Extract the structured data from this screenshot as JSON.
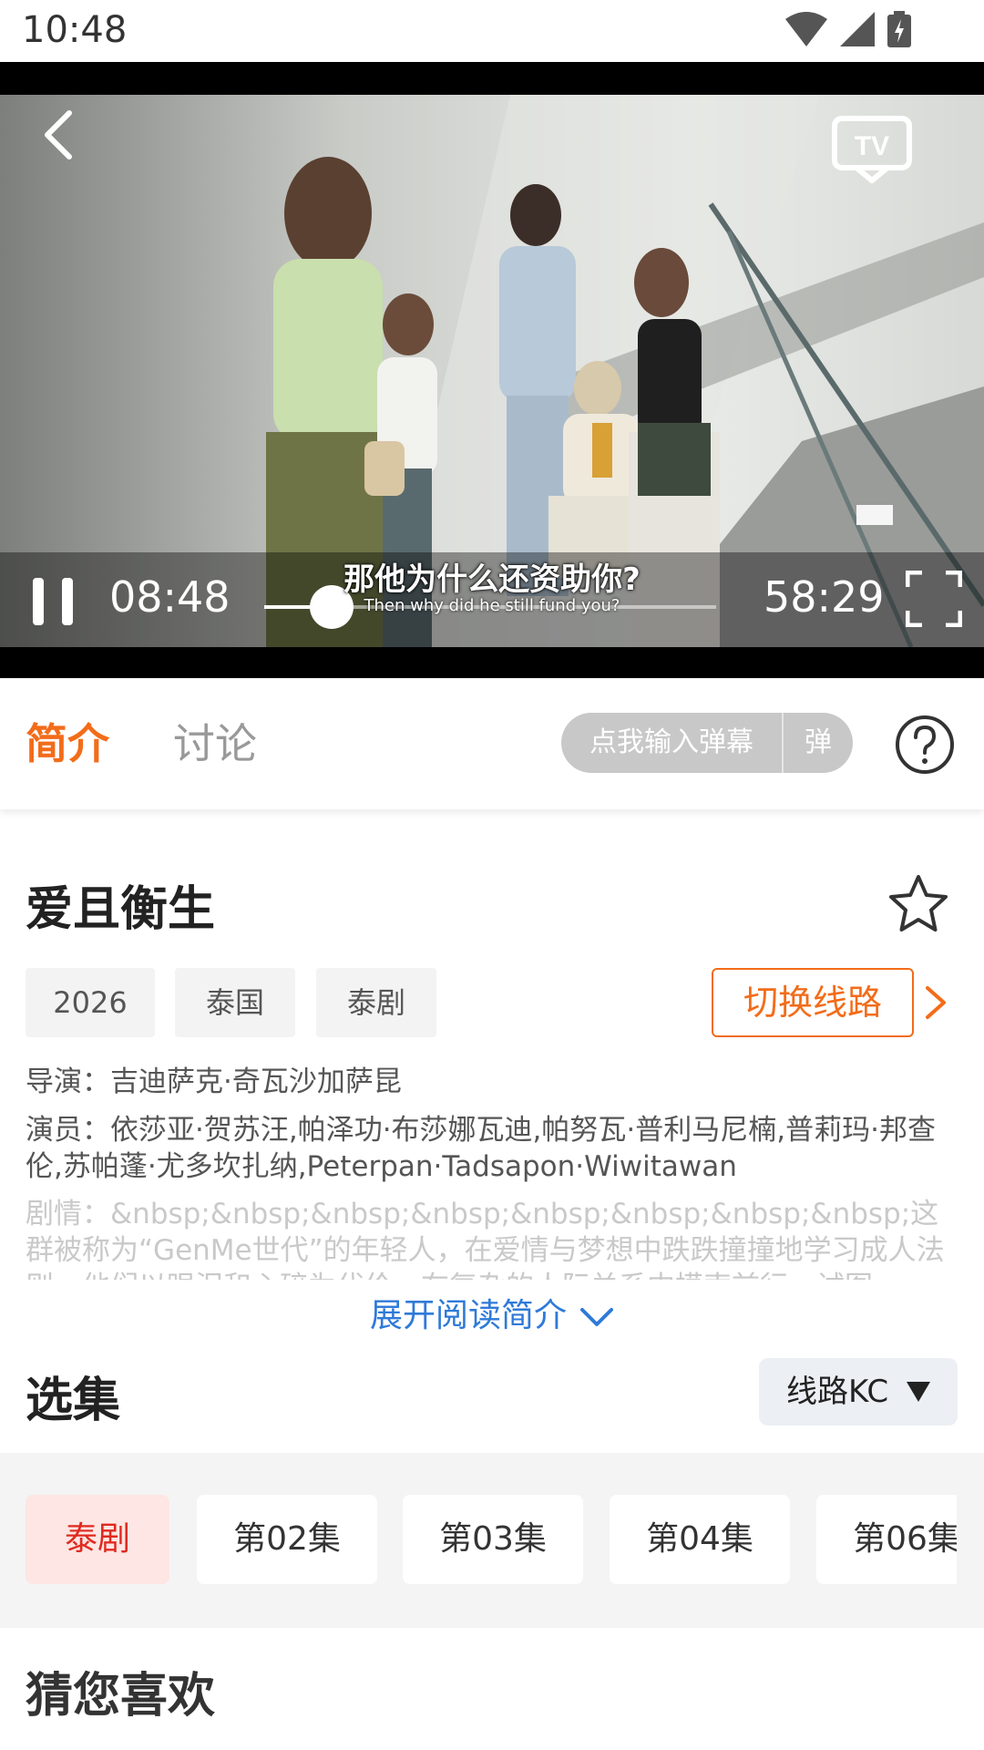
{
  "status_bar": {
    "time": "10:48"
  },
  "player": {
    "current_time": "08:48",
    "total_time": "58:29",
    "progress": 0.15,
    "subtitle_cn": "那他为什么还资助你?",
    "subtitle_en": "Then why did he still fund you?"
  },
  "tabs": {
    "intro": "简介",
    "discuss": "讨论"
  },
  "danmu": {
    "input_label": "点我输入弹幕",
    "send_label": "弹"
  },
  "detail": {
    "title": "爱且衡生",
    "tags": [
      "2026",
      "泰国",
      "泰剧"
    ],
    "switch_label": "切换线路",
    "director": "导演：吉迪萨克·奇瓦沙加萨昆",
    "cast": "演员：依莎亚·贺苏汪,帕泽功·布莎娜瓦迪,帕努瓦·普利马尼楠,普莉玛·邦查伦,苏帕蓬·尤多坎扎纳,Peterpan·Tadsapon·Wiwitawan",
    "plot": "剧情：&nbsp;&nbsp;&nbsp;&nbsp;&nbsp;&nbsp;&nbsp;&nbsp;这群被称为“GenMe世代”的年轻人，在爱情与梦想中跌跌撞撞地学习成人法则，他们以眼泪和心碎为代价，在复杂的人际关系中摸索前行，试图",
    "expand_label": "展开阅读简介"
  },
  "episodes": {
    "section_title": "选集",
    "line_label": "线路KC",
    "items": [
      "泰剧",
      "第02集",
      "第03集",
      "第04集",
      "第06集"
    ]
  },
  "recommend": {
    "title": "猜您喜欢"
  },
  "colors": {
    "accent": "#f36c19",
    "link": "#2f7ad8",
    "active_episode": "#e0291f"
  }
}
